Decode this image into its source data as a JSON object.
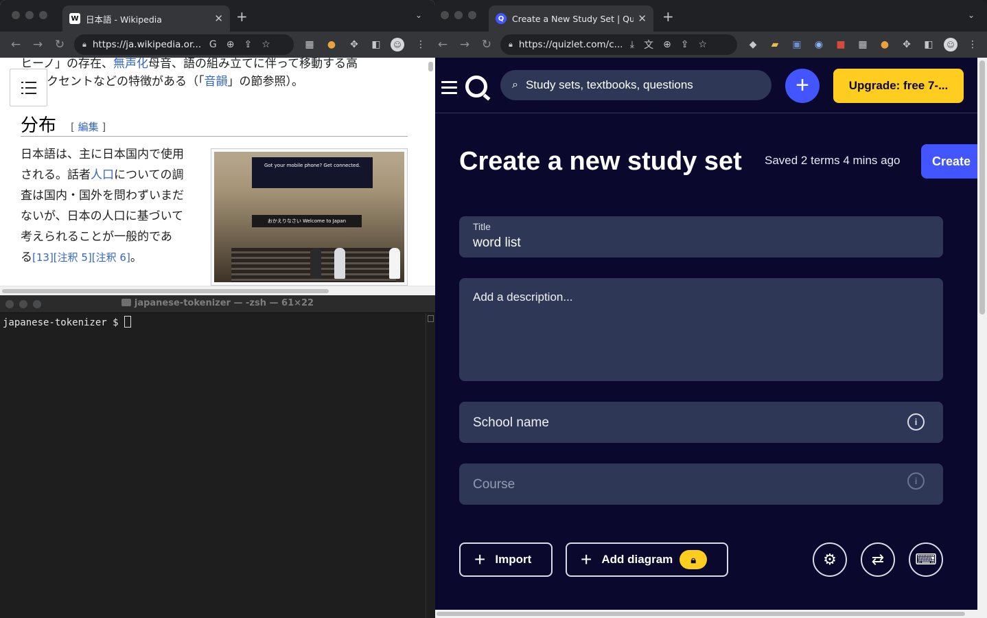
{
  "wiki_window": {
    "tab_title": "日本語 - Wikipedia",
    "url": "https://ja.wikipedia.or...",
    "content": {
      "top_line_a": "ヒーノ」の存在、",
      "top_line_a_link": "無声化",
      "top_line_a_rest": "母音、語の組み立てに伴って移動する高",
      "top_line_b": "クセントなどの特徴がある（「",
      "top_line_b_link": "音韻",
      "top_line_b_rest": "」の節参照）。",
      "section_heading": "分布",
      "edit_open": "[ ",
      "edit_link": "編集",
      "edit_close": " ]",
      "para_1": "日本語は、主に日本国内で使用される。話者",
      "para_link": "人口",
      "para_2": "についての調査は国内・国外を問わずいまだないが、日本の人口に基づいて考えられることが一般的であ",
      "para_3": "る",
      "refs": "[13][注釈 5][注釈 6]",
      "para_end": "。",
      "photo_screen_text": "Got your mobile phone? Get connected.",
      "photo_sign_text": "おかえりなさい  Welcome to Japan"
    }
  },
  "terminal": {
    "title": "japanese-tokenizer — -zsh — 61×22",
    "prompt": "japanese-tokenizer $ "
  },
  "quiz_window": {
    "tab_title": "Create a New Study Set | Quizlet",
    "url": "https://quizlet.com/c...",
    "search_placeholder": "Study sets, textbooks, questions",
    "upgrade_label": "Upgrade: free 7-...",
    "page_title": "Create a new study set",
    "saved_status": "Saved 2 terms 4 mins ago",
    "create_label": "Create",
    "title_field": {
      "label": "Title",
      "value": "word list"
    },
    "description_placeholder": "Add a description...",
    "school_placeholder": "School name",
    "course_placeholder": "Course",
    "import_label": "Import",
    "add_diagram_label": "Add diagram"
  },
  "colors": {
    "quizlet_bg": "#0a092d",
    "quizlet_field": "#2e3856",
    "quizlet_blue": "#4255ff",
    "quizlet_yellow": "#ffcd1f",
    "wiki_link": "#3366cc"
  }
}
